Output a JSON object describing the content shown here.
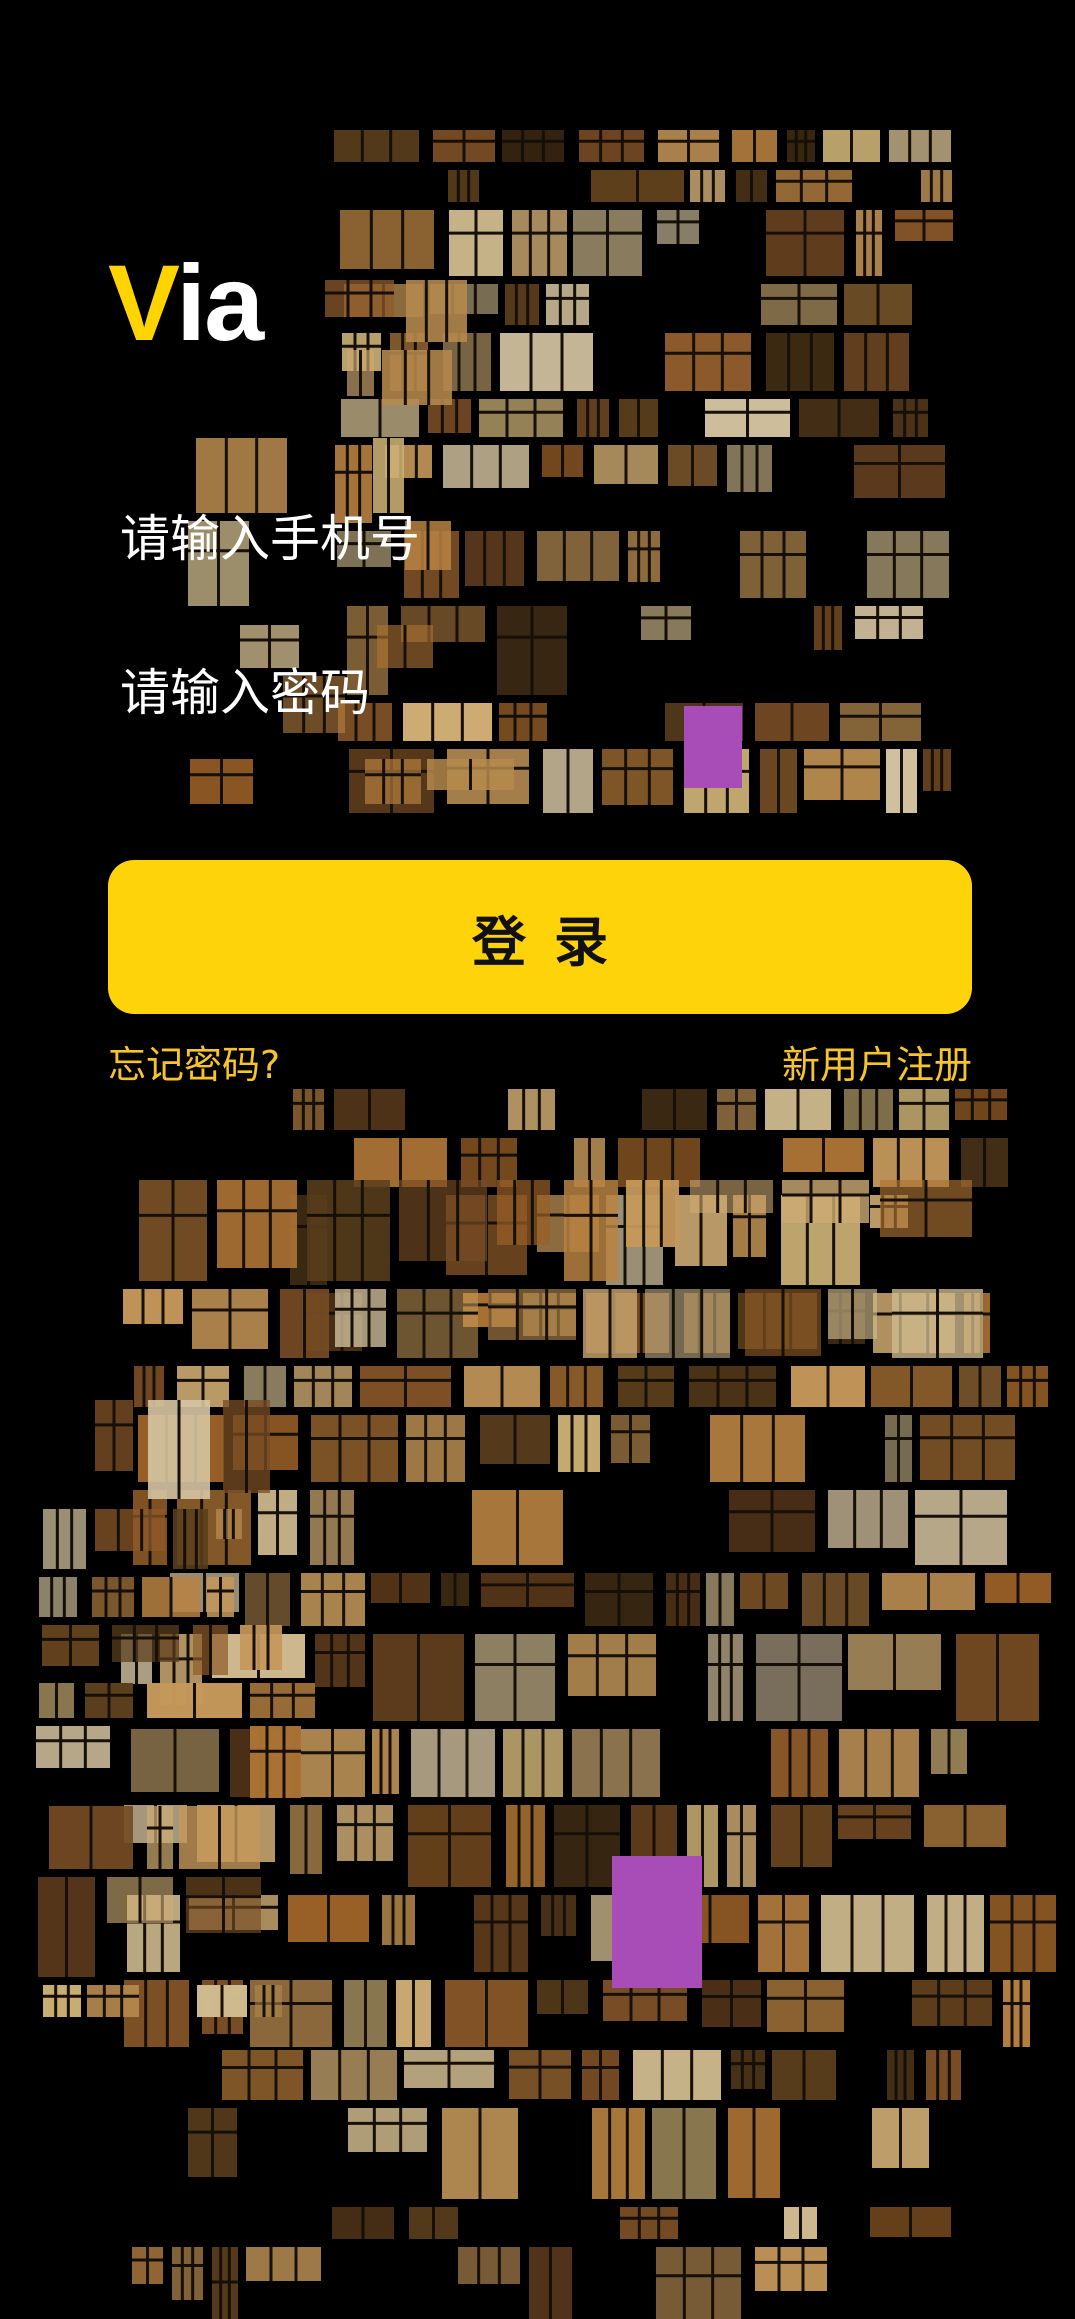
{
  "app": {
    "logo_letter": "V",
    "logo_rest": "ia"
  },
  "form": {
    "phone_placeholder": "请输入手机号",
    "password_placeholder": "请输入密码",
    "login_label": "登录",
    "forgot_label": "忘记密码?",
    "register_label": "新用户注册"
  },
  "background": {
    "description_icon": "lit-windows-collage",
    "colors": {
      "page": "#000000",
      "accent": "#FFD30A",
      "link": "#F7C52B",
      "window_warm": "#E8B36A",
      "window_dark": "#6B4A22",
      "window_purple": "#C65BD8"
    }
  }
}
